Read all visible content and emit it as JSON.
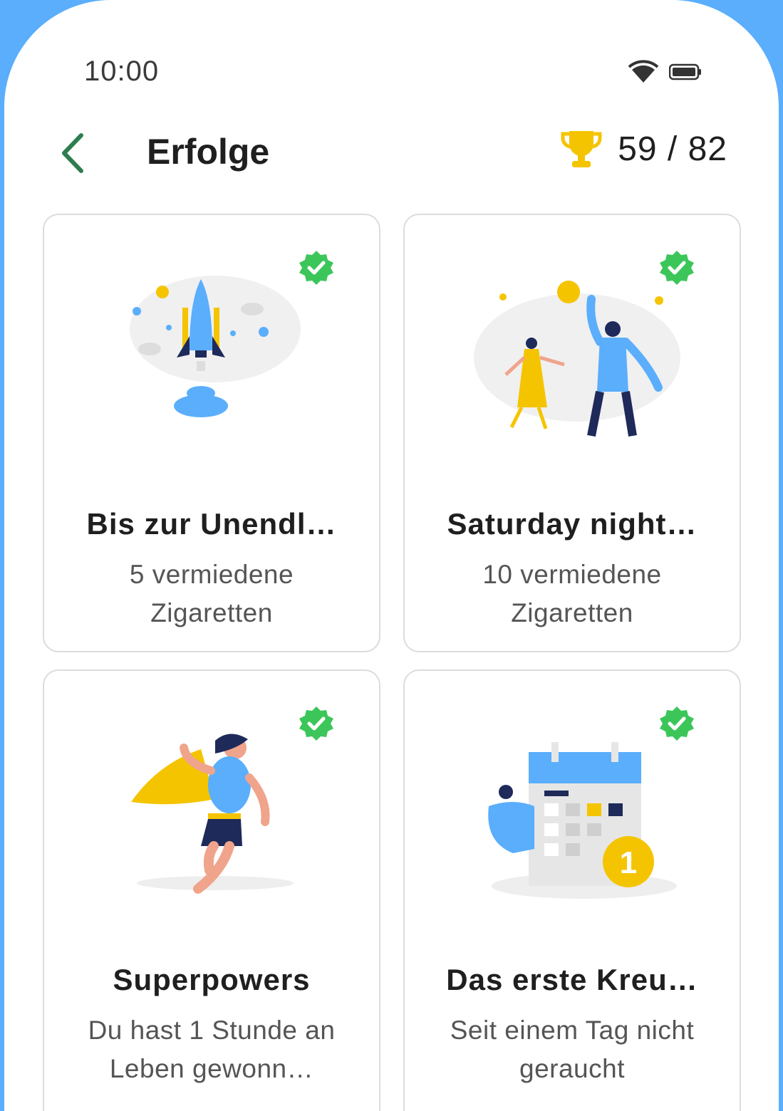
{
  "status": {
    "time": "10:00"
  },
  "header": {
    "title": "Erfolge",
    "score": "59 / 82"
  },
  "colors": {
    "accent": "#2e7d4f",
    "trophy": "#f5c400",
    "badge": "#3cc65a",
    "frame": "#5aaefc"
  },
  "achievements": [
    {
      "title": "Bis zur Unendl…",
      "desc": "5 vermiedene Zigaretten",
      "illustration": "rocket-illustration",
      "done": true
    },
    {
      "title": "Saturday night…",
      "desc": "10 vermiedene Zigaretten",
      "illustration": "dancing-illustration",
      "done": true
    },
    {
      "title": "Superpowers",
      "desc": "Du hast 1 Stunde an Leben gewonn…",
      "illustration": "superhero-illustration",
      "done": true
    },
    {
      "title": "Das erste Kreu…",
      "desc": "Seit einem Tag nicht geraucht",
      "illustration": "calendar-illustration",
      "done": true
    }
  ]
}
